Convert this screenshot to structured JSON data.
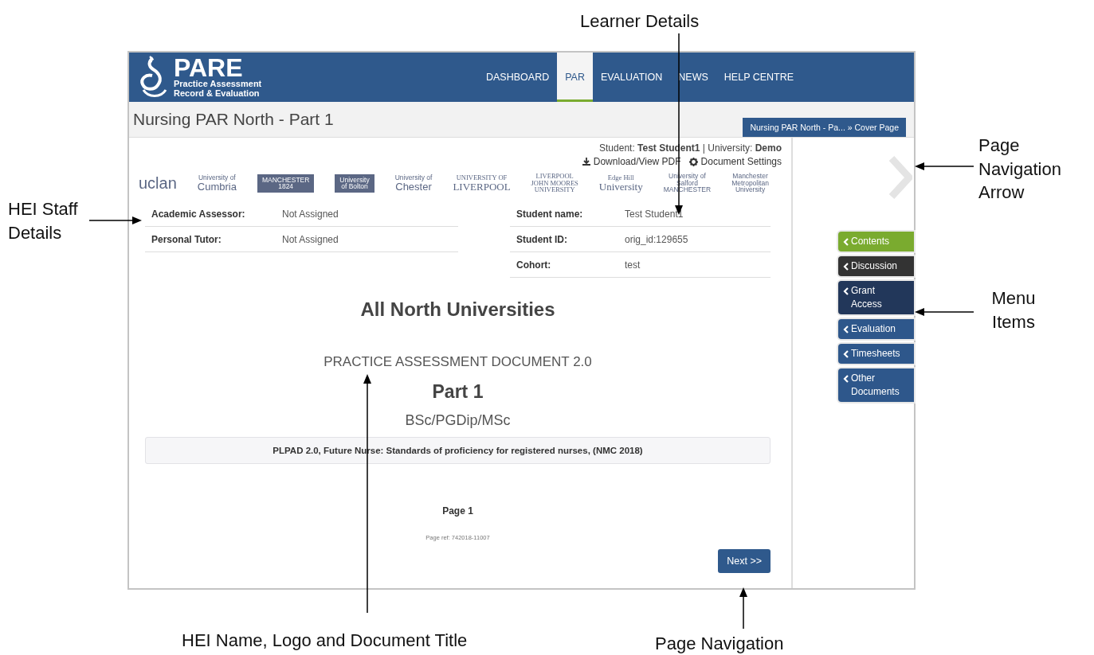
{
  "annotations": [
    {
      "label": "Learner Details"
    },
    {
      "label": "Page Navigation Arrow"
    },
    {
      "label": "HEI Staff Details"
    },
    {
      "label": "Menu Items"
    },
    {
      "label": "HEI Name, Logo and Document Title"
    },
    {
      "label": "Page Navigation"
    }
  ],
  "header": {
    "logo": {
      "title": "PARE",
      "subtitle": [
        "Practice Assessment",
        "Record & Evaluation"
      ]
    },
    "nav": [
      {
        "label": "DASHBOARD",
        "selected": false
      },
      {
        "label": "PAR",
        "selected": true
      },
      {
        "label": "EVALUATION",
        "selected": false
      },
      {
        "label": "NEWS",
        "selected": false
      },
      {
        "label": "HELP CENTRE",
        "selected": false
      }
    ]
  },
  "page_title": "Nursing PAR North - Part 1",
  "breadcrumb": "Nursing PAR North - Pa... » Cover Page",
  "student_line": "Student: **Test Student1** | University: **Demo**",
  "links": [
    {
      "kind": "download",
      "label": "Download/View PDF"
    },
    {
      "kind": "settings",
      "label": "Document Settings"
    }
  ],
  "logos": [
    {
      "kind": "text",
      "lines": [
        "uclan"
      ]
    },
    {
      "kind": "text",
      "lines": [
        "University of",
        "Cumbria"
      ]
    },
    {
      "kind": "block",
      "lines": [
        "MANCHESTER",
        "1824"
      ]
    },
    {
      "kind": "block",
      "lines": [
        "University",
        "of Bolton"
      ]
    },
    {
      "kind": "text",
      "lines": [
        "University of",
        "Chester"
      ]
    },
    {
      "kind": "text",
      "lines": [
        "UNIVERSITY OF",
        "LIVERPOOL"
      ]
    },
    {
      "kind": "text",
      "lines": [
        "LIVERPOOL",
        "JOHN MOORES",
        "UNIVERSITY"
      ]
    },
    {
      "kind": "text",
      "lines": [
        "Edge Hill",
        "University"
      ]
    },
    {
      "kind": "text",
      "lines": [
        "University of",
        "Salford",
        "MANCHESTER"
      ]
    },
    {
      "kind": "text",
      "lines": [
        "Manchester",
        "Metropolitan",
        "University"
      ]
    }
  ],
  "staff_details": [
    {
      "label": "Academic Assessor:",
      "value": "Not Assigned"
    },
    {
      "label": "Personal Tutor:",
      "value": "Not Assigned"
    }
  ],
  "learner_details": [
    {
      "label": "Student name:",
      "value": "Test Student1"
    },
    {
      "label": "Student ID:",
      "value": "orig_id:129655"
    },
    {
      "label": "Cohort:",
      "value": "test"
    }
  ],
  "document": {
    "heading": "All North Universities",
    "subtitle": "PRACTICE ASSESSMENT DOCUMENT 2.0",
    "part": "Part 1",
    "degree": "BSc/PGDip/MSc",
    "standard": "PLPAD 2.0, Future Nurse: Standards of proficiency for registered nurses, (NMC 2018)",
    "page": "Page 1",
    "page_ref": "Page ref: 742018-11007"
  },
  "next_button": "Next >>",
  "side_menu": [
    {
      "lines": [
        "Contents"
      ],
      "color": "#7aab2f"
    },
    {
      "lines": [
        "Discussion"
      ],
      "color": "#333333"
    },
    {
      "lines": [
        "Grant",
        "Access"
      ],
      "color": "#22375a"
    },
    {
      "lines": [
        "Evaluation"
      ],
      "color": "#2e578b"
    },
    {
      "lines": [
        "Timesheets"
      ],
      "color": "#2e578b"
    },
    {
      "lines": [
        "Other",
        "Documents"
      ],
      "color": "#2e578b"
    }
  ]
}
